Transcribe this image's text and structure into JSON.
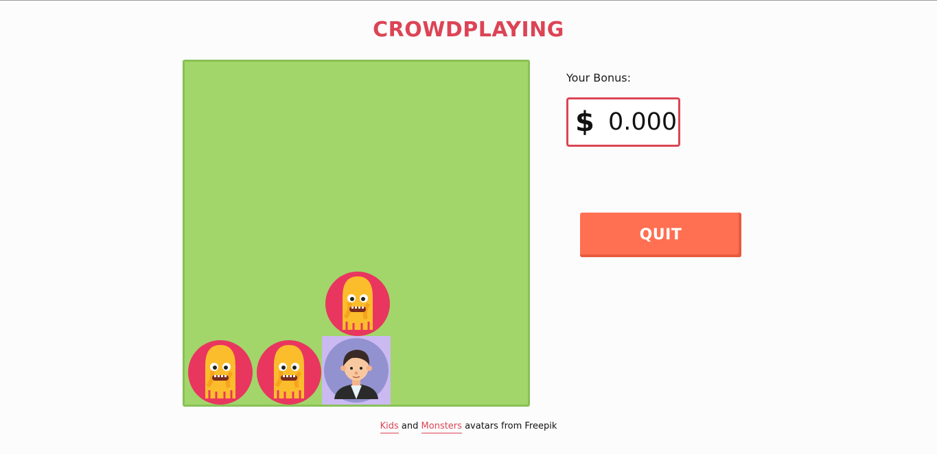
{
  "title": "CROWDPLAYING",
  "bonus": {
    "label": "Your Bonus:",
    "currency": "$",
    "value": "0.000"
  },
  "quit_label": "QUIT",
  "credits": {
    "kids_link": "Kids",
    "and": "and",
    "monsters_link": "Monsters",
    "rest": "avatars from Freepik"
  },
  "board": {
    "background": "#a2d66a",
    "border": "#88c155",
    "pieces": [
      "monster",
      "monster",
      "kid",
      "monster"
    ]
  },
  "colors": {
    "accent": "#dc4455",
    "quit": "#ff7052",
    "monster_bg": "#e8365f",
    "monster_body": "#fbbd2c",
    "kid_bg": "#cbb9f2",
    "kid_circle": "#9392d0"
  }
}
